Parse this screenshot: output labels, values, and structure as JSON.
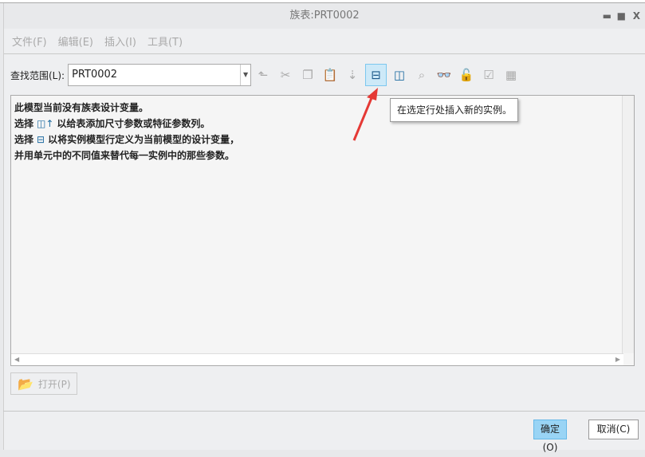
{
  "window": {
    "title": "族表:PRT0002",
    "minimize": "▬",
    "maximize": "■",
    "close": "X"
  },
  "menu": [
    "文件(F)",
    "编辑(E)",
    "插入(I)",
    "工具(T)"
  ],
  "lookup": {
    "label": "查找范围(L):",
    "value": "PRT0002"
  },
  "toolbar": [
    {
      "name": "up-level-icon",
      "glyph": "⬑"
    },
    {
      "name": "cut-icon",
      "glyph": "✂"
    },
    {
      "name": "copy-icon",
      "glyph": "❐"
    },
    {
      "name": "paste-icon",
      "glyph": "📋"
    },
    {
      "name": "fill-down-icon",
      "glyph": "⇣"
    },
    {
      "name": "insert-instance-icon",
      "glyph": "⊟"
    },
    {
      "name": "add-column-icon",
      "glyph": "◫"
    },
    {
      "name": "find-icon",
      "glyph": "⌕"
    },
    {
      "name": "preview-icon",
      "glyph": "👓"
    },
    {
      "name": "lock-icon",
      "glyph": "🔓"
    },
    {
      "name": "verify-icon",
      "glyph": "☑"
    },
    {
      "name": "table-icon",
      "glyph": "▦"
    }
  ],
  "tooltip": "在选定行处插入新的实例。",
  "content": {
    "line1": "此模型当前没有族表设计变量。",
    "line2_pre": "选择",
    "line2_post": "以给表添加尺寸参数或特征参数列。",
    "line3_pre": "选择",
    "line3_post": "以将实例模型行定义为当前模型的设计变量，",
    "line4": "并用单元中的不同值来替代每一实例中的那些参数。"
  },
  "open_button": "打开(P)",
  "ok_button": "确定(O)",
  "cancel_button": "取消(C)",
  "colors": {
    "accent": "#99d4f5",
    "arrow": "#e53935"
  }
}
